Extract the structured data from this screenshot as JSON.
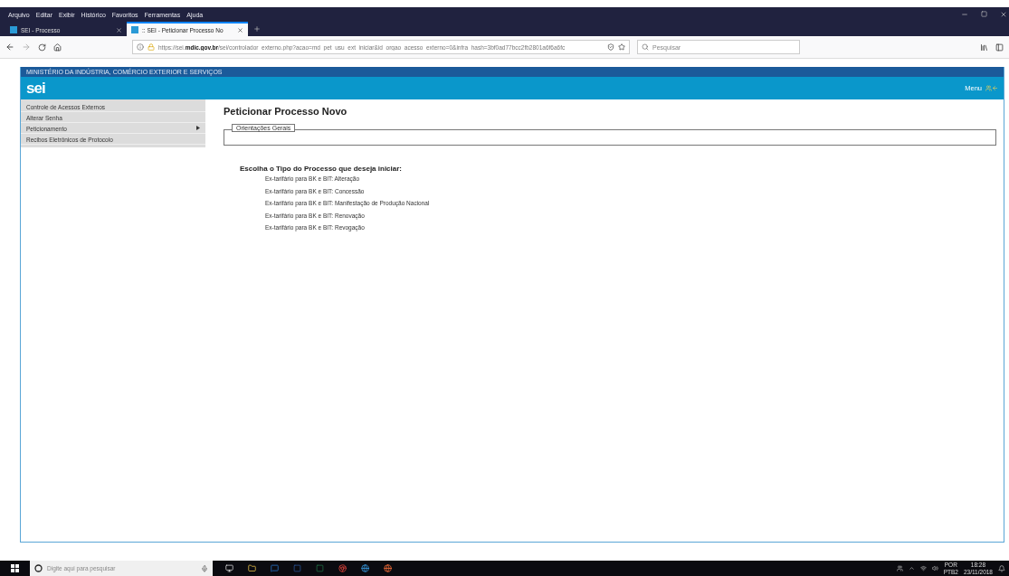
{
  "browser": {
    "menu": [
      "Arquivo",
      "Editar",
      "Exibir",
      "Histórico",
      "Favoritos",
      "Ferramentas",
      "Ajuda"
    ],
    "tabs": [
      {
        "title": "SEI - Processo",
        "selected": false
      },
      {
        "title": ":: SEI - Peticionar Processo No",
        "selected": true
      }
    ],
    "url_prefix": "https://sei.",
    "url_domain": "mdic.gov.br",
    "url_rest": "/sei/controlador_externo.php?acao=md_pet_usu_ext_iniciar&id_orgao_acesso_externo=0&infra_hash=3bf0ad77bcc2fb2801a6f6a6fc",
    "search": {
      "placeholder": "Pesquisar"
    }
  },
  "page": {
    "ministry": "MINISTÉRIO DA INDÚSTRIA, COMÉRCIO EXTERIOR E SERVIÇOS",
    "logo": "sei",
    "menu_link": "Menu",
    "sidebar": {
      "items": [
        {
          "label": "Controle de Acessos Externos",
          "has_submenu": false
        },
        {
          "label": "Alterar Senha",
          "has_submenu": false
        },
        {
          "label": "Peticionamento",
          "has_submenu": true
        },
        {
          "label": "Recibos Eletrônicos de Protocolo",
          "has_submenu": false
        }
      ]
    },
    "title": "Peticionar Processo Novo",
    "fieldset": "Orientações Gerais",
    "prompt": "Escolha o Tipo do Processo que deseja iniciar:",
    "process_types": [
      "Ex-tarifário para BK e BIT: Alteração",
      "Ex-tarifário para BK e BIT: Concessão",
      "Ex-tarifário para BK e BIT: Manifestação de Produção Nacional",
      "Ex-tarifário para BK e BIT: Renovação",
      "Ex-tarifário para BK e BIT: Revogação"
    ]
  },
  "taskbar": {
    "search": {
      "placeholder": "Digite aqui para pesquisar"
    },
    "language": [
      "POR",
      "PTB2"
    ],
    "time": "18:28",
    "date": "23/11/2018"
  }
}
